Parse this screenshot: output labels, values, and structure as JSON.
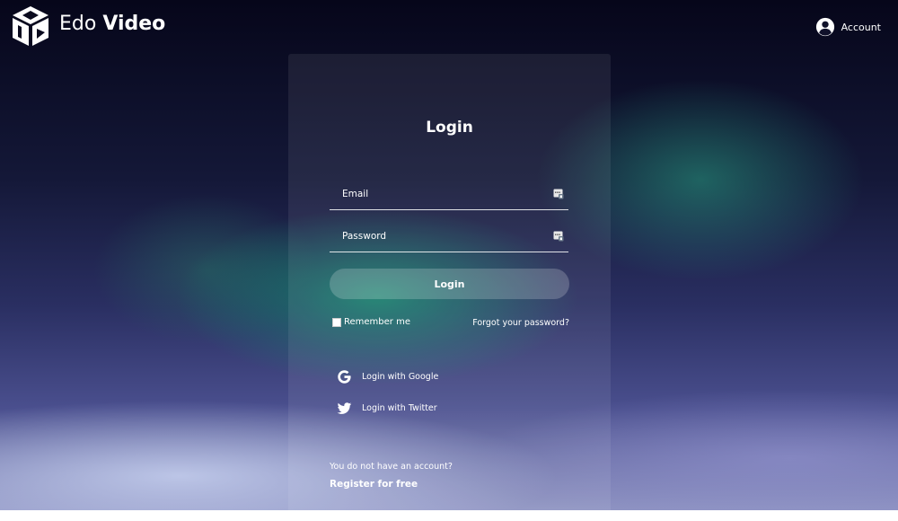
{
  "header": {
    "logo": {
      "word1": "Edo",
      "word2": "Video",
      "icon": "play-cube-icon"
    },
    "account": {
      "label": "Account",
      "icon": "user-circle-icon"
    }
  },
  "login": {
    "title": "Login",
    "email": {
      "placeholder": "Email",
      "value": "",
      "icon": "password-key-icon"
    },
    "password": {
      "placeholder": "Password",
      "value": "",
      "icon": "password-key-icon"
    },
    "submit_label": "Login",
    "remember_label": "Remember me",
    "forgot_label": "Forgot your password?",
    "social": [
      {
        "label": "Login with Google",
        "icon": "google-icon"
      },
      {
        "label": "Login with Twitter",
        "icon": "twitter-icon"
      }
    ],
    "no_account_text": "You do not have an account?",
    "register_label": "Register for free"
  }
}
